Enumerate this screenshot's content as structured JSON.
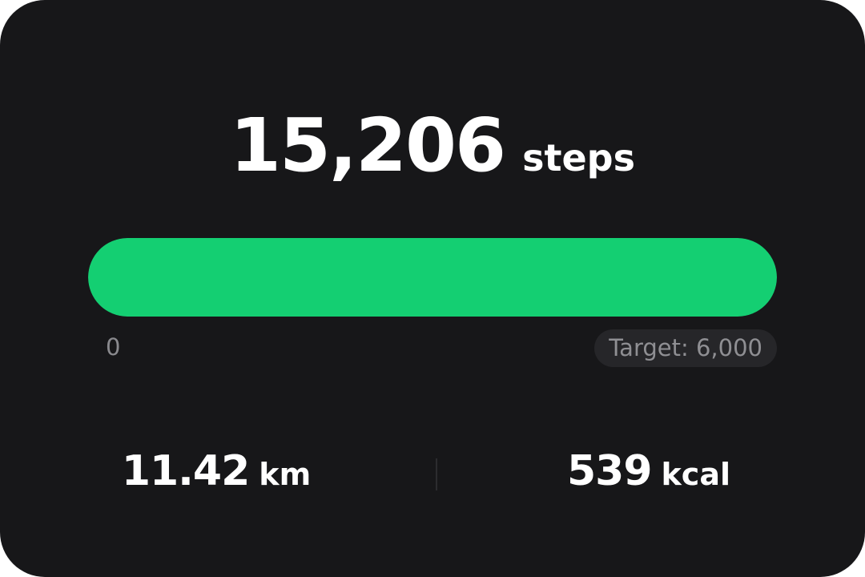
{
  "steps": {
    "value": "15,206",
    "unit": "steps"
  },
  "progress": {
    "min_label": "0",
    "target_label": "Target: 6,000",
    "fill_fraction": 1.0,
    "fill_color": "#14cf72"
  },
  "stats": {
    "distance": {
      "value": "11.42",
      "unit": "km"
    },
    "calories": {
      "value": "539",
      "unit": "kcal"
    }
  }
}
